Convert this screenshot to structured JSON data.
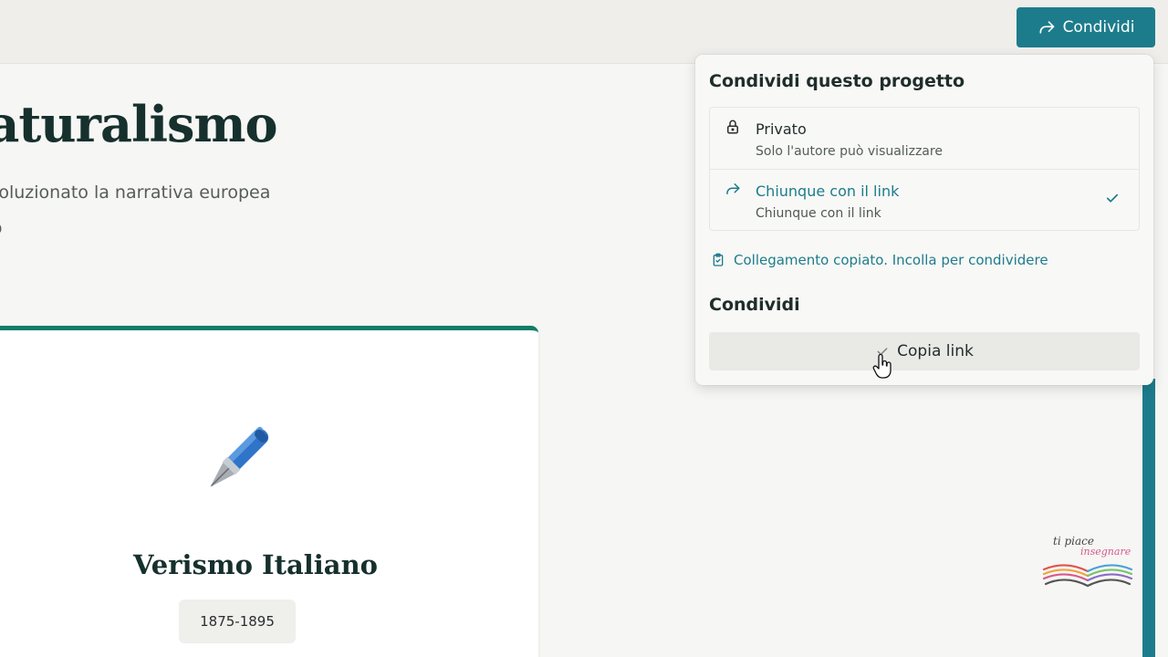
{
  "header": {
    "share_button": {
      "label": "Condividi",
      "icon": "share-icon"
    }
  },
  "hero": {
    "title": "Naturalismo",
    "subtitle": "rivoluzionato la narrativa europea",
    "subtitle_line2": "olo"
  },
  "card": {
    "icon": "fountain-pen-icon",
    "title": "Verismo Italiano",
    "badge": "1875-1895"
  },
  "share_popover": {
    "title": "Condividi questo progetto",
    "options": [
      {
        "label": "Privato",
        "description": "Solo l'autore può visualizzare",
        "icon": "lock-icon",
        "selected": false
      },
      {
        "label": "Chiunque con il link",
        "description": "Chiunque con il link",
        "icon": "share-icon",
        "selected": true
      }
    ],
    "copied_message": "Collegamento copiato. Incolla per condividere",
    "section_title": "Condividi",
    "copy_button": "Copia link"
  },
  "logo": {
    "line1": "ti piace",
    "line2": "insegnare"
  },
  "colors": {
    "accent": "#1d7c8c",
    "card_border": "#0f7d67",
    "background": "#f6f6f4"
  }
}
